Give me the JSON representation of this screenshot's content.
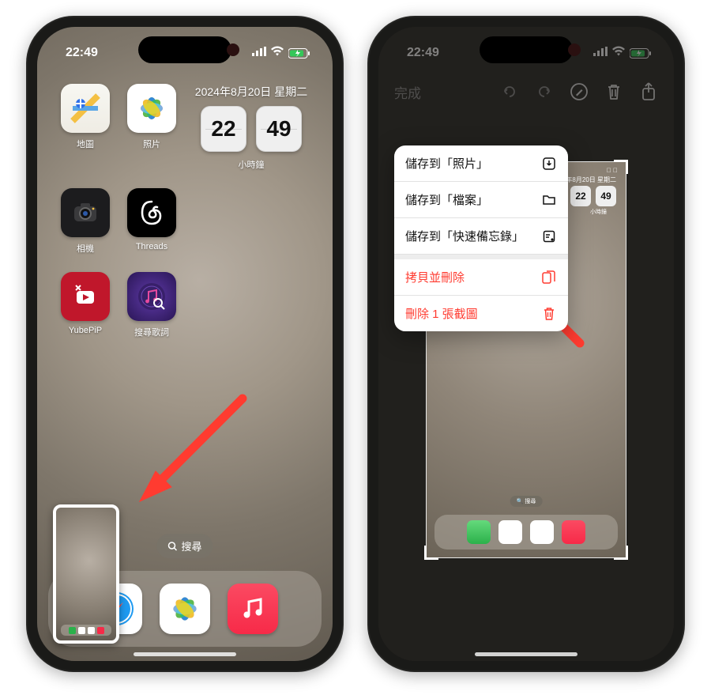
{
  "status": {
    "time": "22:49",
    "date_line": "2024年8月20日 星期二"
  },
  "clock": {
    "hour": "22",
    "minute": "49",
    "label": "小時鐘"
  },
  "apps": {
    "maps": {
      "label": "地圖"
    },
    "photos": {
      "label": "照片"
    },
    "camera": {
      "label": "相機"
    },
    "threads": {
      "label": "Threads"
    },
    "yubepip": {
      "label": "YubePiP"
    },
    "lyrics": {
      "label": "搜尋歌詞"
    }
  },
  "search": {
    "label": "搜尋"
  },
  "editor": {
    "done": "完成"
  },
  "menu": {
    "save_photos": "儲存到「照片」",
    "save_files": "儲存到「檔案」",
    "save_notes": "儲存到「快速備忘錄」",
    "copy_delete": "拷貝並刪除",
    "delete_one": "刪除 1 張截圖"
  }
}
